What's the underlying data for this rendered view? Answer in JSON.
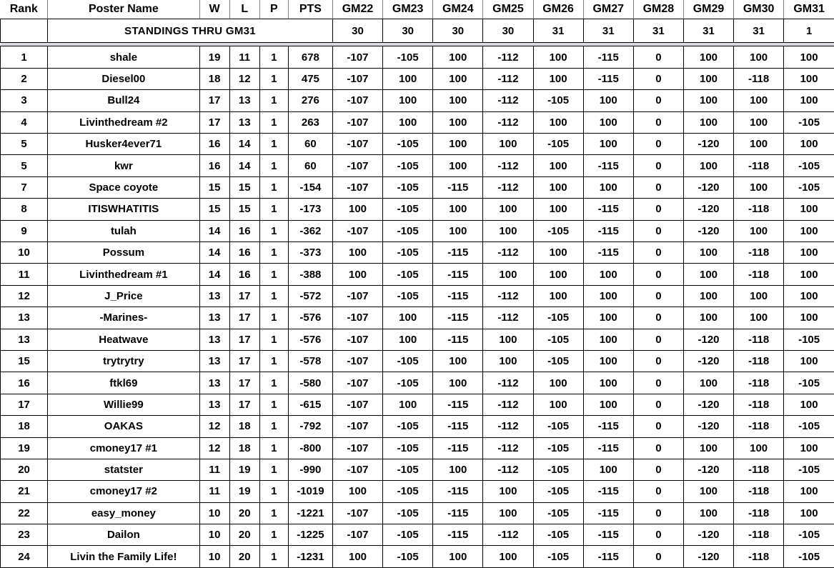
{
  "table": {
    "headers": {
      "rank": "Rank",
      "name": "Poster Name",
      "w": "W",
      "l": "L",
      "p": "P",
      "pts": "PTS",
      "games": [
        "GM22",
        "GM23",
        "GM24",
        "GM25",
        "GM26",
        "GM27",
        "GM28",
        "GM29",
        "GM30",
        "GM31"
      ]
    },
    "banner": {
      "title": "STANDINGS THRU GM31",
      "game_counts": [
        "30",
        "30",
        "30",
        "30",
        "31",
        "31",
        "31",
        "31",
        "31",
        "1"
      ]
    },
    "colors": {
      "rank_bg": "#ff0000",
      "rank_text": "#ffffff",
      "name_bg": "#eedce4",
      "record_bg": "#00ee00",
      "record_text": "#1111dd",
      "banner_bg": "#ffff00",
      "banner_text": "#2222cc",
      "game_bg": "#ffffff",
      "game_text": "#000000"
    },
    "rows": [
      {
        "rank": "1",
        "name": "shale",
        "w": "19",
        "l": "11",
        "p": "1",
        "pts": "678",
        "games": [
          "-107",
          "-105",
          "100",
          "-112",
          "100",
          "-115",
          "0",
          "100",
          "100",
          "100"
        ]
      },
      {
        "rank": "2",
        "name": "Diesel00",
        "w": "18",
        "l": "12",
        "p": "1",
        "pts": "475",
        "games": [
          "-107",
          "100",
          "100",
          "-112",
          "100",
          "-115",
          "0",
          "100",
          "-118",
          "100"
        ]
      },
      {
        "rank": "3",
        "name": "Bull24",
        "w": "17",
        "l": "13",
        "p": "1",
        "pts": "276",
        "games": [
          "-107",
          "100",
          "100",
          "-112",
          "-105",
          "100",
          "0",
          "100",
          "100",
          "100"
        ]
      },
      {
        "rank": "4",
        "name": "Livinthedream #2",
        "w": "17",
        "l": "13",
        "p": "1",
        "pts": "263",
        "games": [
          "-107",
          "100",
          "100",
          "-112",
          "100",
          "100",
          "0",
          "100",
          "100",
          "-105"
        ]
      },
      {
        "rank": "5",
        "name": "Husker4ever71",
        "w": "16",
        "l": "14",
        "p": "1",
        "pts": "60",
        "games": [
          "-107",
          "-105",
          "100",
          "100",
          "-105",
          "100",
          "0",
          "-120",
          "100",
          "100"
        ]
      },
      {
        "rank": "5",
        "name": "kwr",
        "w": "16",
        "l": "14",
        "p": "1",
        "pts": "60",
        "games": [
          "-107",
          "-105",
          "100",
          "-112",
          "100",
          "-115",
          "0",
          "100",
          "-118",
          "-105"
        ]
      },
      {
        "rank": "7",
        "name": "Space coyote",
        "w": "15",
        "l": "15",
        "p": "1",
        "pts": "-154",
        "games": [
          "-107",
          "-105",
          "-115",
          "-112",
          "100",
          "100",
          "0",
          "-120",
          "100",
          "-105"
        ]
      },
      {
        "rank": "8",
        "name": "ITISWHATITIS",
        "w": "15",
        "l": "15",
        "p": "1",
        "pts": "-173",
        "games": [
          "100",
          "-105",
          "100",
          "100",
          "100",
          "-115",
          "0",
          "-120",
          "-118",
          "100"
        ]
      },
      {
        "rank": "9",
        "name": "tulah",
        "w": "14",
        "l": "16",
        "p": "1",
        "pts": "-362",
        "games": [
          "-107",
          "-105",
          "100",
          "100",
          "-105",
          "-115",
          "0",
          "-120",
          "100",
          "100"
        ]
      },
      {
        "rank": "10",
        "name": "Possum",
        "w": "14",
        "l": "16",
        "p": "1",
        "pts": "-373",
        "games": [
          "100",
          "-105",
          "-115",
          "-112",
          "100",
          "-115",
          "0",
          "100",
          "-118",
          "100"
        ]
      },
      {
        "rank": "11",
        "name": "Livinthedream #1",
        "w": "14",
        "l": "16",
        "p": "1",
        "pts": "-388",
        "games": [
          "100",
          "-105",
          "-115",
          "100",
          "100",
          "100",
          "0",
          "100",
          "-118",
          "100"
        ]
      },
      {
        "rank": "12",
        "name": "J_Price",
        "w": "13",
        "l": "17",
        "p": "1",
        "pts": "-572",
        "games": [
          "-107",
          "-105",
          "-115",
          "-112",
          "100",
          "100",
          "0",
          "100",
          "100",
          "100"
        ]
      },
      {
        "rank": "13",
        "name": "-Marines-",
        "w": "13",
        "l": "17",
        "p": "1",
        "pts": "-576",
        "games": [
          "-107",
          "100",
          "-115",
          "-112",
          "-105",
          "100",
          "0",
          "100",
          "100",
          "100"
        ]
      },
      {
        "rank": "13",
        "name": "Heatwave",
        "w": "13",
        "l": "17",
        "p": "1",
        "pts": "-576",
        "games": [
          "-107",
          "100",
          "-115",
          "100",
          "-105",
          "100",
          "0",
          "-120",
          "-118",
          "-105"
        ]
      },
      {
        "rank": "15",
        "name": "trytrytry",
        "w": "13",
        "l": "17",
        "p": "1",
        "pts": "-578",
        "games": [
          "-107",
          "-105",
          "100",
          "100",
          "-105",
          "100",
          "0",
          "-120",
          "-118",
          "100"
        ]
      },
      {
        "rank": "16",
        "name": "ftkl69",
        "w": "13",
        "l": "17",
        "p": "1",
        "pts": "-580",
        "games": [
          "-107",
          "-105",
          "100",
          "-112",
          "100",
          "100",
          "0",
          "100",
          "-118",
          "-105"
        ]
      },
      {
        "rank": "17",
        "name": "Willie99",
        "w": "13",
        "l": "17",
        "p": "1",
        "pts": "-615",
        "games": [
          "-107",
          "100",
          "-115",
          "-112",
          "100",
          "100",
          "0",
          "-120",
          "-118",
          "100"
        ]
      },
      {
        "rank": "18",
        "name": "OAKAS",
        "w": "12",
        "l": "18",
        "p": "1",
        "pts": "-792",
        "games": [
          "-107",
          "-105",
          "-115",
          "-112",
          "-105",
          "-115",
          "0",
          "-120",
          "-118",
          "-105"
        ]
      },
      {
        "rank": "19",
        "name": "cmoney17 #1",
        "w": "12",
        "l": "18",
        "p": "1",
        "pts": "-800",
        "games": [
          "-107",
          "-105",
          "-115",
          "-112",
          "-105",
          "-115",
          "0",
          "100",
          "100",
          "100"
        ]
      },
      {
        "rank": "20",
        "name": "statster",
        "w": "11",
        "l": "19",
        "p": "1",
        "pts": "-990",
        "games": [
          "-107",
          "-105",
          "100",
          "-112",
          "-105",
          "100",
          "0",
          "-120",
          "-118",
          "-105"
        ]
      },
      {
        "rank": "21",
        "name": "cmoney17 #2",
        "w": "11",
        "l": "19",
        "p": "1",
        "pts": "-1019",
        "games": [
          "100",
          "-105",
          "-115",
          "100",
          "-105",
          "-115",
          "0",
          "100",
          "-118",
          "100"
        ]
      },
      {
        "rank": "22",
        "name": "easy_money",
        "w": "10",
        "l": "20",
        "p": "1",
        "pts": "-1221",
        "games": [
          "-107",
          "-105",
          "-115",
          "100",
          "-105",
          "-115",
          "0",
          "100",
          "-118",
          "100"
        ]
      },
      {
        "rank": "23",
        "name": "Dailon",
        "w": "10",
        "l": "20",
        "p": "1",
        "pts": "-1225",
        "games": [
          "-107",
          "-105",
          "-115",
          "-112",
          "-105",
          "-115",
          "0",
          "-120",
          "-118",
          "-105"
        ]
      },
      {
        "rank": "24",
        "name": "Livin the Family Life!",
        "w": "10",
        "l": "20",
        "p": "1",
        "pts": "-1231",
        "games": [
          "100",
          "-105",
          "100",
          "100",
          "-105",
          "-115",
          "0",
          "-120",
          "-118",
          "-105"
        ]
      }
    ]
  }
}
